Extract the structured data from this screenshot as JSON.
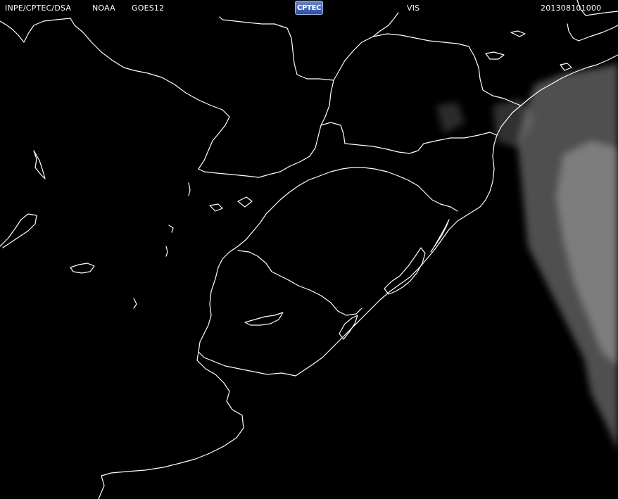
{
  "header": {
    "source": "INPE/CPTEC/DSA",
    "agency": "NOAA",
    "satellite": "GOES12",
    "logo": "CPTEC",
    "channel": "VIS",
    "timestamp": "201308101000"
  },
  "colors": {
    "background": "#000000",
    "outline": "#ffffff",
    "cloud": "#9a9a9a",
    "logo_top": "#6a86c8",
    "logo_bottom": "#2b4ea0"
  }
}
